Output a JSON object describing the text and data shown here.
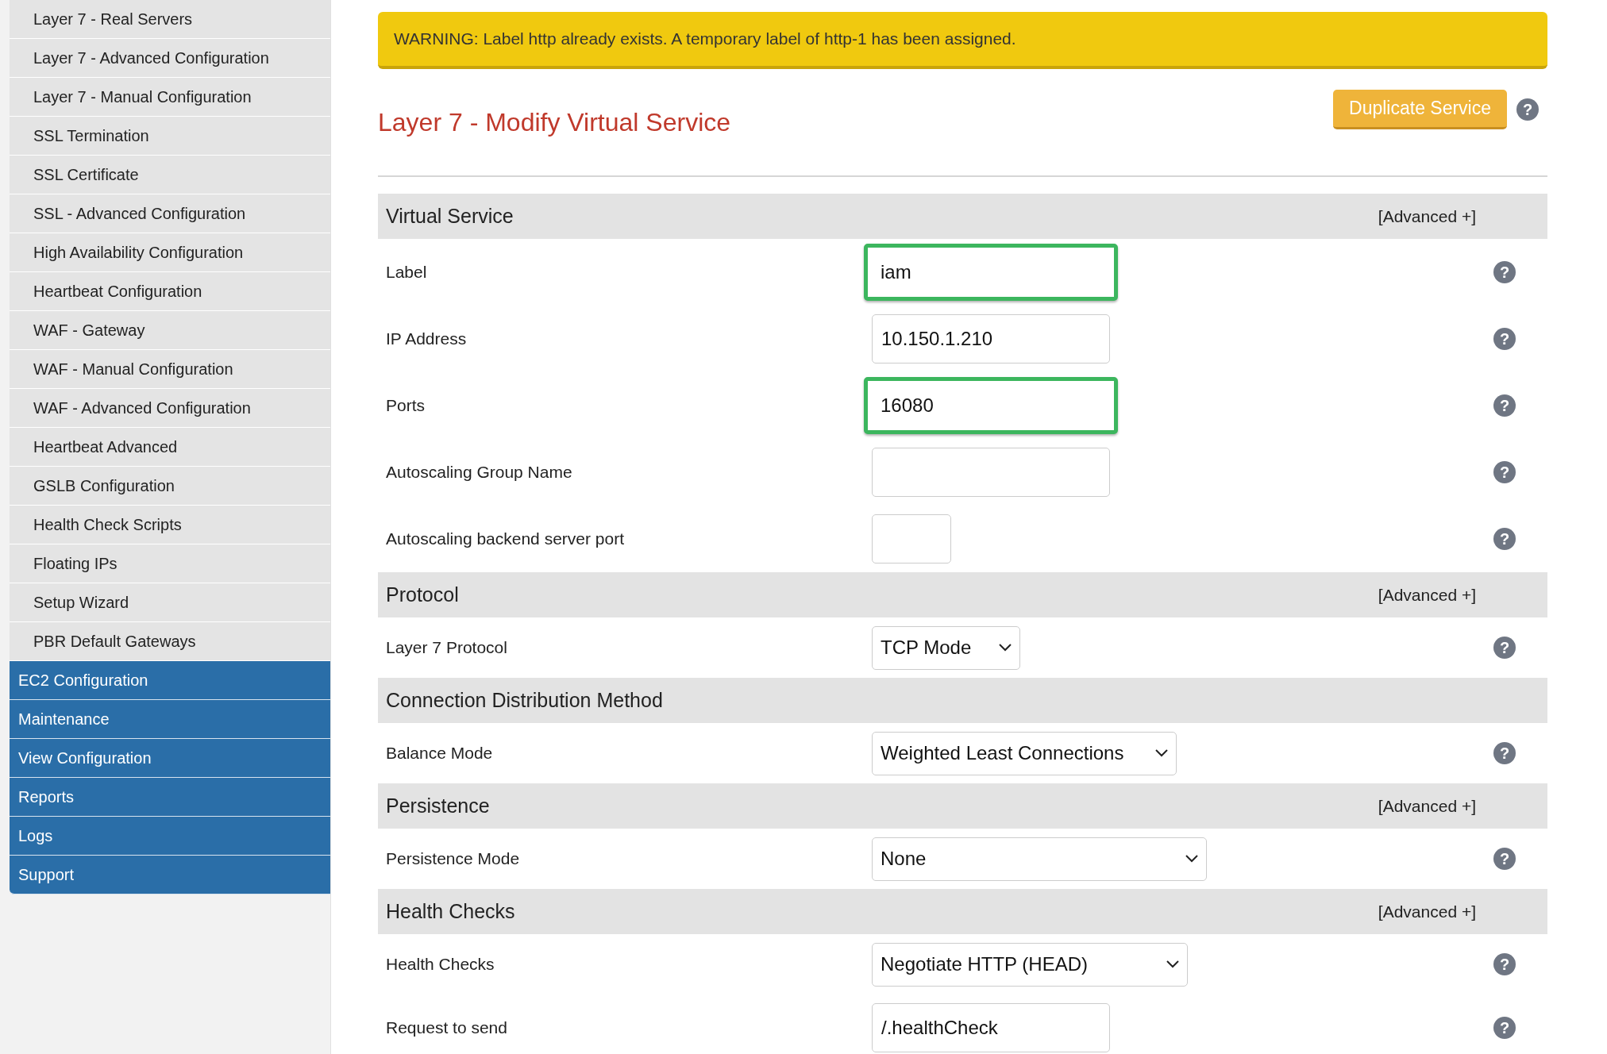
{
  "sidebar": {
    "items": [
      {
        "label": "Layer 7 - Real Servers",
        "kind": "sub"
      },
      {
        "label": "Layer 7 - Advanced Configuration",
        "kind": "sub"
      },
      {
        "label": "Layer 7 - Manual Configuration",
        "kind": "sub"
      },
      {
        "label": "SSL Termination",
        "kind": "sub"
      },
      {
        "label": "SSL Certificate",
        "kind": "sub"
      },
      {
        "label": "SSL - Advanced Configuration",
        "kind": "sub"
      },
      {
        "label": "High Availability Configuration",
        "kind": "sub"
      },
      {
        "label": "Heartbeat Configuration",
        "kind": "sub"
      },
      {
        "label": "WAF - Gateway",
        "kind": "sub"
      },
      {
        "label": "WAF - Manual Configuration",
        "kind": "sub"
      },
      {
        "label": "WAF - Advanced Configuration",
        "kind": "sub"
      },
      {
        "label": "Heartbeat Advanced",
        "kind": "sub"
      },
      {
        "label": "GSLB Configuration",
        "kind": "sub"
      },
      {
        "label": "Health Check Scripts",
        "kind": "sub"
      },
      {
        "label": "Floating IPs",
        "kind": "sub"
      },
      {
        "label": "Setup Wizard",
        "kind": "sub"
      },
      {
        "label": "PBR Default Gateways",
        "kind": "sub"
      },
      {
        "label": "EC2 Configuration",
        "kind": "main"
      },
      {
        "label": "Maintenance",
        "kind": "main"
      },
      {
        "label": "View Configuration",
        "kind": "main"
      },
      {
        "label": "Reports",
        "kind": "main"
      },
      {
        "label": "Logs",
        "kind": "main"
      },
      {
        "label": "Support",
        "kind": "main"
      }
    ]
  },
  "warning": {
    "text": "WARNING: Label http already exists. A temporary label of http-1 has been assigned."
  },
  "page_title": "Layer 7 - Modify Virtual Service",
  "duplicate_button": {
    "label": "Duplicate Service",
    "help": "?"
  },
  "sections": [
    {
      "title": "Virtual Service",
      "advanced": "[Advanced +]",
      "rows": [
        {
          "label": "Label",
          "kind": "text",
          "value": "iam",
          "highlighted": true,
          "help": "?"
        },
        {
          "label": "IP Address",
          "kind": "text",
          "value": "10.150.1.210",
          "highlighted": false,
          "help": "?"
        },
        {
          "label": "Ports",
          "kind": "text",
          "value": "16080",
          "highlighted": true,
          "help": "?"
        },
        {
          "label": "Autoscaling Group Name",
          "kind": "text",
          "highlighted": false,
          "help": "?"
        },
        {
          "label": "Autoscaling backend server port",
          "kind": "short",
          "highlighted": false,
          "help": "?"
        }
      ]
    },
    {
      "title": "Protocol",
      "advanced": "[Advanced +]",
      "rows": [
        {
          "label": "Layer 7 Protocol",
          "kind": "select",
          "value": "TCP Mode",
          "help": "?"
        }
      ]
    },
    {
      "title": "Connection Distribution Method",
      "rows": [
        {
          "label": "Balance Mode",
          "kind": "select",
          "value": "Weighted Least Connections",
          "help": "?"
        }
      ]
    },
    {
      "title": "Persistence",
      "advanced": "[Advanced +]",
      "rows": [
        {
          "label": "Persistence Mode",
          "kind": "select",
          "value": "None",
          "help": "?"
        }
      ]
    },
    {
      "title": "Health Checks",
      "advanced": "[Advanced +]",
      "rows": [
        {
          "label": "Health Checks",
          "kind": "select",
          "value": "Negotiate HTTP (HEAD)",
          "help": "?"
        },
        {
          "label": "Request to send",
          "kind": "text",
          "value": "/.healthCheck",
          "highlighted": false,
          "help": "?"
        }
      ]
    }
  ]
}
